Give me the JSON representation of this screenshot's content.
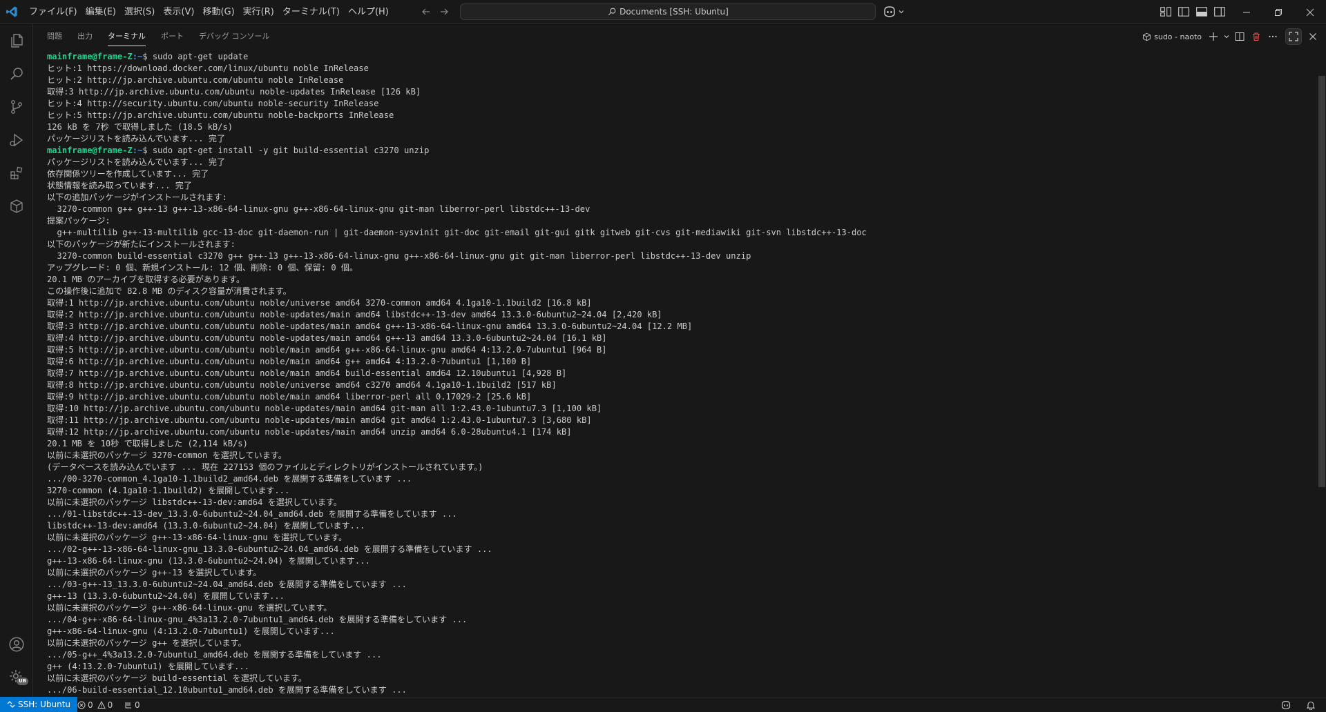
{
  "titlebar": {
    "menu": [
      "ファイル(F)",
      "編集(E)",
      "選択(S)",
      "表示(V)",
      "移動(G)",
      "実行(R)",
      "ターミナル(T)",
      "ヘルプ(H)"
    ],
    "search_text": "Documents [SSH: Ubuntu]"
  },
  "panel": {
    "tabs": [
      "問題",
      "出力",
      "ターミナル",
      "ポート",
      "デバッグ コンソール"
    ],
    "active_tab": "ターミナル",
    "terminal_name": "sudo - naoto"
  },
  "terminal": {
    "prompt_user": "mainframe@frame-Z",
    "prompt_path": ":~",
    "lines": [
      {
        "prompt": true,
        "cmd": "$ sudo apt-get update"
      },
      {
        "text": "ヒット:1 https://download.docker.com/linux/ubuntu noble InRelease"
      },
      {
        "text": "ヒット:2 http://jp.archive.ubuntu.com/ubuntu noble InRelease"
      },
      {
        "text": "取得:3 http://jp.archive.ubuntu.com/ubuntu noble-updates InRelease [126 kB]"
      },
      {
        "text": "ヒット:4 http://security.ubuntu.com/ubuntu noble-security InRelease"
      },
      {
        "text": "ヒット:5 http://jp.archive.ubuntu.com/ubuntu noble-backports InRelease"
      },
      {
        "text": "126 kB を 7秒 で取得しました (18.5 kB/s)"
      },
      {
        "text": "パッケージリストを読み込んでいます... 完了"
      },
      {
        "prompt": true,
        "cmd": "$ sudo apt-get install -y git build-essential c3270 unzip"
      },
      {
        "text": "パッケージリストを読み込んでいます... 完了"
      },
      {
        "text": "依存関係ツリーを作成しています... 完了"
      },
      {
        "text": "状態情報を読み取っています... 完了"
      },
      {
        "text": "以下の追加パッケージがインストールされます:"
      },
      {
        "text": "  3270-common g++ g++-13 g++-13-x86-64-linux-gnu g++-x86-64-linux-gnu git-man liberror-perl libstdc++-13-dev"
      },
      {
        "text": "提案パッケージ:"
      },
      {
        "text": "  g++-multilib g++-13-multilib gcc-13-doc git-daemon-run | git-daemon-sysvinit git-doc git-email git-gui gitk gitweb git-cvs git-mediawiki git-svn libstdc++-13-doc"
      },
      {
        "text": "以下のパッケージが新たにインストールされます:"
      },
      {
        "text": "  3270-common build-essential c3270 g++ g++-13 g++-13-x86-64-linux-gnu g++-x86-64-linux-gnu git git-man liberror-perl libstdc++-13-dev unzip"
      },
      {
        "text": "アップグレード: 0 個、新規インストール: 12 個、削除: 0 個、保留: 0 個。"
      },
      {
        "text": "20.1 MB のアーカイブを取得する必要があります。"
      },
      {
        "text": "この操作後に追加で 82.8 MB のディスク容量が消費されます。"
      },
      {
        "text": "取得:1 http://jp.archive.ubuntu.com/ubuntu noble/universe amd64 3270-common amd64 4.1ga10-1.1build2 [16.8 kB]"
      },
      {
        "text": "取得:2 http://jp.archive.ubuntu.com/ubuntu noble-updates/main amd64 libstdc++-13-dev amd64 13.3.0-6ubuntu2~24.04 [2,420 kB]"
      },
      {
        "text": "取得:3 http://jp.archive.ubuntu.com/ubuntu noble-updates/main amd64 g++-13-x86-64-linux-gnu amd64 13.3.0-6ubuntu2~24.04 [12.2 MB]"
      },
      {
        "text": "取得:4 http://jp.archive.ubuntu.com/ubuntu noble-updates/main amd64 g++-13 amd64 13.3.0-6ubuntu2~24.04 [16.1 kB]"
      },
      {
        "text": "取得:5 http://jp.archive.ubuntu.com/ubuntu noble/main amd64 g++-x86-64-linux-gnu amd64 4:13.2.0-7ubuntu1 [964 B]"
      },
      {
        "text": "取得:6 http://jp.archive.ubuntu.com/ubuntu noble/main amd64 g++ amd64 4:13.2.0-7ubuntu1 [1,100 B]"
      },
      {
        "text": "取得:7 http://jp.archive.ubuntu.com/ubuntu noble/main amd64 build-essential amd64 12.10ubuntu1 [4,928 B]"
      },
      {
        "text": "取得:8 http://jp.archive.ubuntu.com/ubuntu noble/universe amd64 c3270 amd64 4.1ga10-1.1build2 [517 kB]"
      },
      {
        "text": "取得:9 http://jp.archive.ubuntu.com/ubuntu noble/main amd64 liberror-perl all 0.17029-2 [25.6 kB]"
      },
      {
        "text": "取得:10 http://jp.archive.ubuntu.com/ubuntu noble-updates/main amd64 git-man all 1:2.43.0-1ubuntu7.3 [1,100 kB]"
      },
      {
        "text": "取得:11 http://jp.archive.ubuntu.com/ubuntu noble-updates/main amd64 git amd64 1:2.43.0-1ubuntu7.3 [3,680 kB]"
      },
      {
        "text": "取得:12 http://jp.archive.ubuntu.com/ubuntu noble-updates/main amd64 unzip amd64 6.0-28ubuntu4.1 [174 kB]"
      },
      {
        "text": "20.1 MB を 10秒 で取得しました (2,114 kB/s)"
      },
      {
        "text": "以前に未選択のパッケージ 3270-common を選択しています。"
      },
      {
        "text": "(データベースを読み込んでいます ... 現在 227153 個のファイルとディレクトリがインストールされています。)"
      },
      {
        "text": ".../00-3270-common_4.1ga10-1.1build2_amd64.deb を展開する準備をしています ..."
      },
      {
        "text": "3270-common (4.1ga10-1.1build2) を展開しています..."
      },
      {
        "text": "以前に未選択のパッケージ libstdc++-13-dev:amd64 を選択しています。"
      },
      {
        "text": ".../01-libstdc++-13-dev_13.3.0-6ubuntu2~24.04_amd64.deb を展開する準備をしています ..."
      },
      {
        "text": "libstdc++-13-dev:amd64 (13.3.0-6ubuntu2~24.04) を展開しています..."
      },
      {
        "text": "以前に未選択のパッケージ g++-13-x86-64-linux-gnu を選択しています。"
      },
      {
        "text": ".../02-g++-13-x86-64-linux-gnu_13.3.0-6ubuntu2~24.04_amd64.deb を展開する準備をしています ..."
      },
      {
        "text": "g++-13-x86-64-linux-gnu (13.3.0-6ubuntu2~24.04) を展開しています..."
      },
      {
        "text": "以前に未選択のパッケージ g++-13 を選択しています。"
      },
      {
        "text": ".../03-g++-13_13.3.0-6ubuntu2~24.04_amd64.deb を展開する準備をしています ..."
      },
      {
        "text": "g++-13 (13.3.0-6ubuntu2~24.04) を展開しています..."
      },
      {
        "text": "以前に未選択のパッケージ g++-x86-64-linux-gnu を選択しています。"
      },
      {
        "text": ".../04-g++-x86-64-linux-gnu_4%3a13.2.0-7ubuntu1_amd64.deb を展開する準備をしています ..."
      },
      {
        "text": "g++-x86-64-linux-gnu (4:13.2.0-7ubuntu1) を展開しています..."
      },
      {
        "text": "以前に未選択のパッケージ g++ を選択しています。"
      },
      {
        "text": ".../05-g++_4%3a13.2.0-7ubuntu1_amd64.deb を展開する準備をしています ..."
      },
      {
        "text": "g++ (4:13.2.0-7ubuntu1) を展開しています..."
      },
      {
        "text": "以前に未選択のパッケージ build-essential を選択しています。"
      },
      {
        "text": ".../06-build-essential_12.10ubuntu1_amd64.deb を展開する準備をしています ..."
      }
    ]
  },
  "statusbar": {
    "remote": "SSH: Ubuntu",
    "errors": "0",
    "warnings": "0",
    "ports": "0",
    "account_badge": "UB"
  },
  "colors": {
    "accent": "#0078d4",
    "prompt_user": "#23d18b",
    "prompt_path": "#3b8eea"
  }
}
